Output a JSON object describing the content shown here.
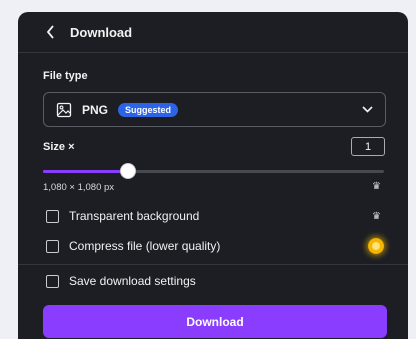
{
  "header": {
    "title": "Download",
    "back_icon": "chevron-left-icon"
  },
  "file_type": {
    "label": "File type",
    "selected": "PNG",
    "badge": "Suggested",
    "icon": "image-icon",
    "badge_color": "#2d63e6"
  },
  "size": {
    "label": "Size ×",
    "multiplier": "1",
    "dimensions": "1,080 × 1,080 px",
    "slider_fraction": 0.25,
    "pro_icon": "crown-icon"
  },
  "options": {
    "transparent": "Transparent background",
    "compress": "Compress file (lower quality)",
    "save_settings": "Save download settings"
  },
  "download_button": "Download",
  "colors": {
    "accent": "#8b3dff",
    "panel": "#1d1e23"
  }
}
